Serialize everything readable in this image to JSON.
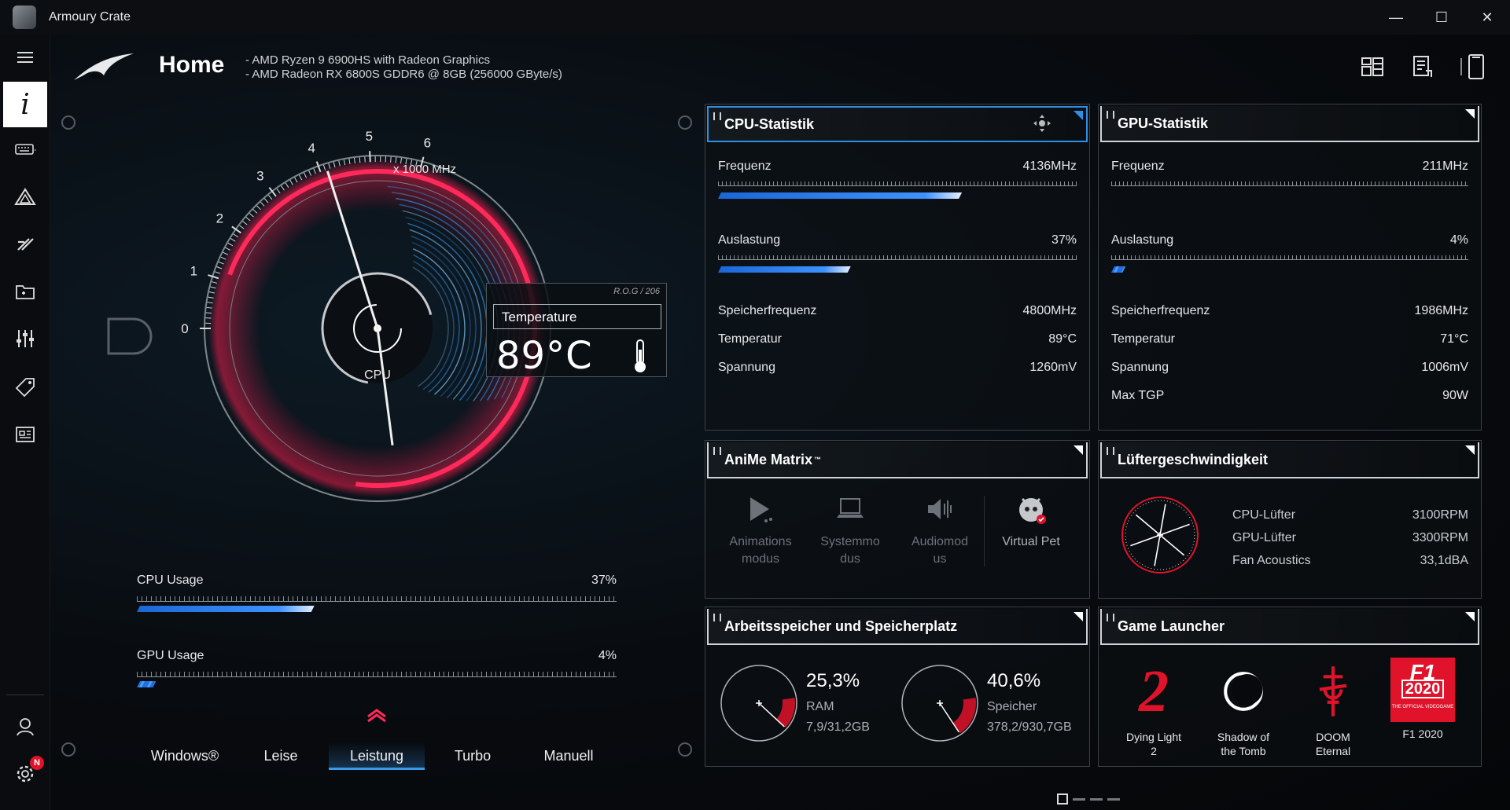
{
  "window": {
    "title": "Armoury Crate",
    "minimize": "—",
    "maximize": "☐",
    "close": "✕"
  },
  "header": {
    "title": "Home",
    "spec_cpu": "-   AMD Ryzen 9 6900HS with Radeon Graphics",
    "spec_gpu": "-   AMD Radeon RX 6800S GDDR6 @ 8GB (256000 GByte/s)"
  },
  "sidebar": {
    "active_glyph": "i",
    "settings_badge": "N"
  },
  "gauge": {
    "unit_label": "x 1000 MHz",
    "cpu_label": "CPU",
    "ticks": [
      "0",
      "1",
      "2",
      "3",
      "4",
      "5",
      "6"
    ],
    "freq_ghz": 4.136
  },
  "temperature": {
    "code": "R.O.G / 206",
    "label": "Temperature",
    "value": "89°C"
  },
  "usage": {
    "cpu": {
      "label": "CPU Usage",
      "value": "37%",
      "pct": 37
    },
    "gpu": {
      "label": "GPU Usage",
      "value": "4%",
      "pct": 4
    }
  },
  "modes": [
    "Windows®",
    "Leise",
    "Leistung",
    "Turbo",
    "Manuell"
  ],
  "active_mode": "Leistung",
  "cpu_stats": {
    "title": "CPU-Statistik",
    "freq_label": "Frequenz",
    "freq_value": "4136MHz",
    "freq_pct": 68,
    "load_label": "Auslastung",
    "load_value": "37%",
    "load_pct": 37,
    "memfreq_label": "Speicherfrequenz",
    "memfreq_value": "4800MHz",
    "temp_label": "Temperatur",
    "temp_value": "89°C",
    "volt_label": "Spannung",
    "volt_value": "1260mV"
  },
  "gpu_stats": {
    "title": "GPU-Statistik",
    "freq_label": "Frequenz",
    "freq_value": "211MHz",
    "load_label": "Auslastung",
    "load_value": "4%",
    "load_pct": 4,
    "memfreq_label": "Speicherfrequenz",
    "memfreq_value": "1986MHz",
    "temp_label": "Temperatur",
    "temp_value": "71°C",
    "volt_label": "Spannung",
    "volt_value": "1006mV",
    "tgp_label": "Max TGP",
    "tgp_value": "90W"
  },
  "anime": {
    "title": "AniMe Matrix",
    "tm": "™",
    "items": [
      {
        "l1": "Animations",
        "l2": "modus"
      },
      {
        "l1": "Systemmo",
        "l2": "dus"
      },
      {
        "l1": "Audiomod",
        "l2": "us"
      },
      {
        "l1": "Virtual Pet",
        "l2": ""
      }
    ]
  },
  "fans": {
    "title": "Lüftergeschwindigkeit",
    "cpu_label": "CPU-Lüfter",
    "cpu_value": "3100RPM",
    "gpu_label": "GPU-Lüfter",
    "gpu_value": "3300RPM",
    "ac_label": "Fan Acoustics",
    "ac_value": "33,1dBA"
  },
  "memory": {
    "title": "Arbeitsspeicher und Speicherplatz",
    "ram_pct": "25,3%",
    "ram_label": "RAM",
    "ram_value": "7,9/31,2GB",
    "ram_frac": 0.253,
    "disk_pct": "40,6%",
    "disk_label": "Speicher",
    "disk_value": "378,2/930,7GB",
    "disk_frac": 0.406
  },
  "games": {
    "title": "Game Launcher",
    "items": [
      {
        "l1": "Dying Light",
        "l2": "2"
      },
      {
        "l1": "Shadow of",
        "l2": "the Tomb"
      },
      {
        "l1": "DOOM",
        "l2": "Eternal"
      },
      {
        "l1": "F1 2020",
        "l2": ""
      }
    ],
    "dl_glyph": "2",
    "f1_glyph": "F1",
    "f1_year": "2020",
    "f1_sub": "THE OFFICIAL VIDEOGAME"
  },
  "colors": {
    "accent": "#2f8fe6",
    "brand_red": "#e0132b"
  }
}
